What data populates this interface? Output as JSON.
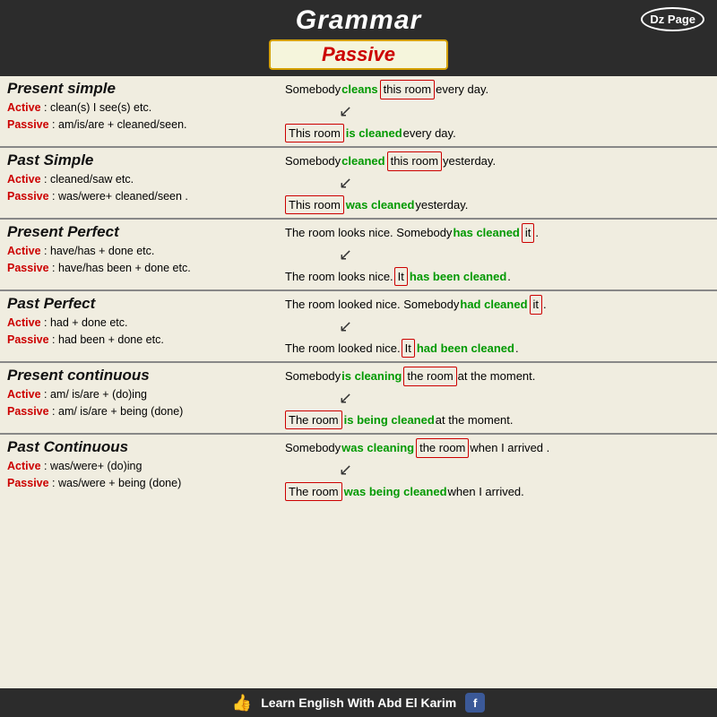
{
  "header": {
    "title": "Grammar",
    "badge": "Dz Page",
    "passive_label": "Passive"
  },
  "sections": [
    {
      "id": "present-simple",
      "title": "Present simple",
      "active_rule": "Active : clean(s) I see(s) etc.",
      "passive_rule": "Passive : am/is/are + cleaned/seen.",
      "example_active": "Somebody cleans this room every day.",
      "example_passive": "This room is cleaned every day.",
      "green_active": "cleans",
      "green_passive": "is cleaned",
      "box_active": "this room",
      "box_passive": "This room"
    },
    {
      "id": "past-simple",
      "title": "Past Simple",
      "active_rule": "Active : cleaned/saw etc.",
      "passive_rule": "Passive : was/were+ cleaned/seen .",
      "example_active": "Somebody cleaned this room yesterday.",
      "example_passive": "This room was cleaned yesterday.",
      "green_active": "cleaned",
      "green_passive": "was cleaned",
      "box_active": "this room",
      "box_passive": "This room"
    },
    {
      "id": "present-perfect",
      "title": "Present Perfect",
      "active_rule": "Active : have/has + done etc.",
      "passive_rule": "Passive : have/has been + done etc.",
      "example_active": "The room looks nice. Somebody has cleaned it .",
      "example_passive": "The room looks nice. It has been cleaned.",
      "green_active": "has cleaned",
      "green_passive": "has been cleaned",
      "box_active": "it",
      "box_passive": "It"
    },
    {
      "id": "past-perfect",
      "title": "Past Perfect",
      "active_rule": "Active : had + done etc.",
      "passive_rule": "Passive : had been + done etc.",
      "example_active": "The room looked nice. Somebody had cleaned it .",
      "example_passive": "The room looked nice. It had been cleaned.",
      "green_active": "had cleaned",
      "green_passive": "had been cleaned",
      "box_active": "it",
      "box_passive": "It"
    },
    {
      "id": "present-continuous",
      "title": "Present continuous",
      "active_rule": "Active : am/ is/are + (do)ing",
      "passive_rule": "Passive : am/ is/are + being (done)",
      "example_active": "Somebody is cleaning the room at the moment.",
      "example_passive": "The room is being cleaned at the moment.",
      "green_active": "is cleaning",
      "green_passive": "is being cleaned",
      "box_active": "the room",
      "box_passive": "The room"
    },
    {
      "id": "past-continuous",
      "title": "Past Continuous",
      "active_rule": "Active : was/were+ (do)ing",
      "passive_rule": "Passive : was/were + being (done)",
      "example_active": "Somebody was cleaning the room when I arrived .",
      "example_passive": "The room was being cleaned when I arrived.",
      "green_active": "was cleaning",
      "green_passive": "was being cleaned",
      "box_active": "the room",
      "box_passive": "The room"
    }
  ],
  "footer": {
    "text": "Learn English With Abd El Karim",
    "thumb_icon": "👍",
    "fb_icon": "f"
  }
}
